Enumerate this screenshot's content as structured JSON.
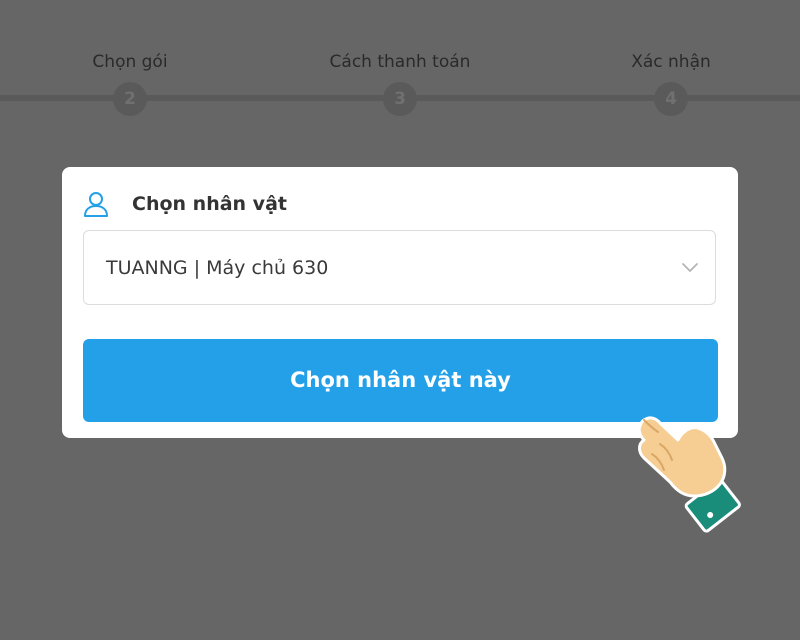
{
  "stepper": {
    "steps": [
      {
        "label": "Chọn gói",
        "number": "2"
      },
      {
        "label": "Cách thanh toán",
        "number": "3"
      },
      {
        "label": "Xác nhận",
        "number": "4"
      }
    ]
  },
  "character_card": {
    "title": "Chọn nhân vật",
    "icon": "user-icon",
    "select": {
      "value": "TUANNG | Máy chủ 630",
      "icon": "chevron-down-icon"
    },
    "button_label": "Chọn nhân vật này"
  },
  "overlay": {
    "icon": "pointing-hand-icon"
  },
  "colors": {
    "backdrop": "#666666",
    "accent": "#23a0e8",
    "card": "#ffffff"
  }
}
